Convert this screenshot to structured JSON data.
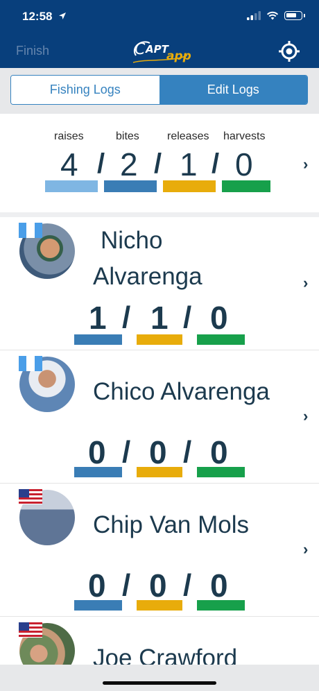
{
  "status_bar": {
    "time": "12:58"
  },
  "nav": {
    "finish_label": "Finish",
    "logo_text": "CAPTapp"
  },
  "segments": [
    {
      "label": "Fishing Logs",
      "selected": false
    },
    {
      "label": "Edit Logs",
      "selected": true
    }
  ],
  "summary": {
    "labels": [
      "raises",
      "bites",
      "releases",
      "harvests"
    ],
    "values": [
      "4",
      "2",
      "1",
      "0"
    ],
    "separator": "/"
  },
  "anglers": [
    {
      "name_line1": "Nicho",
      "name_line2": "Alvarenga",
      "flag": "guatemala",
      "bites": "1",
      "releases": "1",
      "harvests": "0"
    },
    {
      "name_line1": "Chico Alvarenga",
      "flag": "guatemala",
      "bites": "0",
      "releases": "0",
      "harvests": "0"
    },
    {
      "name_line1": "Chip  Van Mols",
      "flag": "usa",
      "bites": "0",
      "releases": "0",
      "harvests": "0"
    },
    {
      "name_line1": "Joe Crawford",
      "flag": "usa"
    }
  ],
  "colors": {
    "navy": "#083f7c",
    "raises": "#7fb6e3",
    "bites": "#3a7db5",
    "releases": "#e8ac0b",
    "harvests": "#17a04b",
    "segment_accent": "#3582bf"
  },
  "icons": {
    "chevron": "chevron-right-icon",
    "locate": "crosshair-icon"
  }
}
